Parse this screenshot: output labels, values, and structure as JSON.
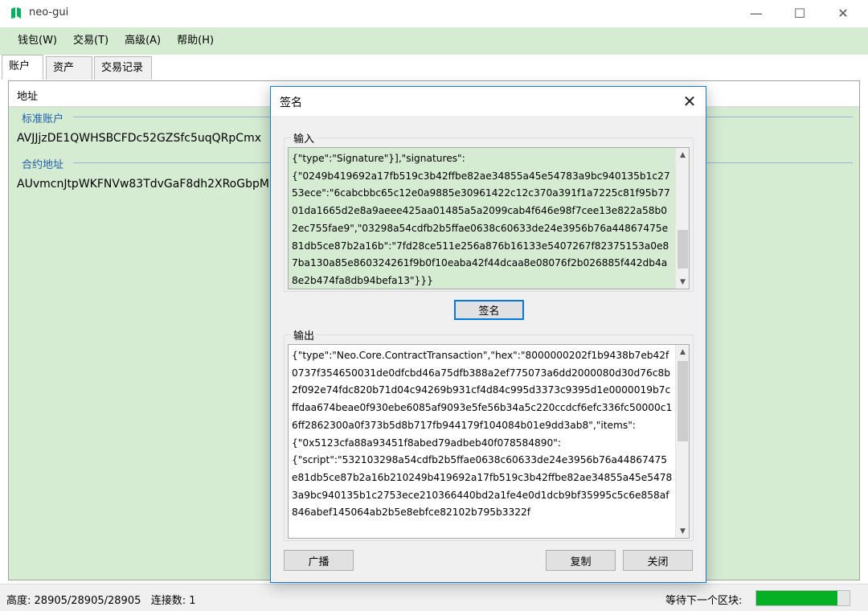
{
  "app": {
    "title": "neo-gui",
    "brand_color": "#00af5c"
  },
  "window_controls": {
    "minimize": "—",
    "maximize": "☐",
    "close": "✕"
  },
  "menu": [
    {
      "label": "钱包(W)"
    },
    {
      "label": "交易(T)"
    },
    {
      "label": "高级(A)"
    },
    {
      "label": "帮助(H)"
    }
  ],
  "tabs": [
    {
      "label": "账户",
      "active": true
    },
    {
      "label": "资产",
      "active": false
    },
    {
      "label": "交易记录",
      "active": false
    }
  ],
  "accounts": {
    "column_header": "地址",
    "groups": [
      {
        "label": "标准账户",
        "address": "AVJJjzDE1QWHSBCFDc52GZSfc5uqQRpCmx"
      },
      {
        "label": "合约地址",
        "address": "AUvmcnJtpWKFNVw83TdvGaF8dh2XRoGbpM"
      }
    ]
  },
  "status": {
    "height_label": "高度:",
    "height_value": "28905/28905/28905",
    "connections_label": "连接数:",
    "connections_value": "1",
    "waiting_label": "等待下一个区块:",
    "progress_fraction": 0.87,
    "progress_color": "#06b025"
  },
  "dialog": {
    "title": "签名",
    "close_glyph": "✕",
    "input_label": "输入",
    "input_text": "{\"type\":\"Signature\"}],\"signatures\":\n{\"0249b419692a17fb519c3b42ffbe82ae34855a45e54783a9bc940135b1c2753ece\":\"6cabcbbc65c12e0a9885e30961422c12c370a391f1a7225c81f95b7701da1665d2e8a9aeee425aa01485a5a2099cab4f646e98f7cee13e822a58b02ec755fae9\",\"03298a54cdfb2b5ffae0638c60633de24e3956b76a44867475e81db5ce87b2a16b\":\"7fd28ce511e256a876b16133e5407267f82375153a0e87ba130a85e860324261f9b0f10eaba42f44dcaa8e08076f2b026885f442db4a8e2b474fa8db94befa13\"}}}",
    "input_bg": "#d5ebd2",
    "sign_button": "签名",
    "output_label": "输出",
    "output_text": "{\"type\":\"Neo.Core.ContractTransaction\",\"hex\":\"8000000202f1b9438b7eb42f0737f354650031de0dfcbd46a75dfb388a2ef775073a6dd2000080d30d76c8b2f092e74fdc820b71d04c94269b931cf4d84c995d3373c9395d1e0000019b7cffdaa674beae0f930ebe6085af9093e5fe56b34a5c220ccdcf6efc336fc50000c16ff2862300a0f373b5d8b717fb944179f104084b01e9dd3ab8\",\"items\":\n{\"0x5123cfa88a93451f8abed79adbeb40f078584890\":\n{\"script\":\"532103298a54cdfb2b5ffae0638c60633de24e3956b76a44867475e81db5ce87b2a16b210249b419692a17fb519c3b42ffbe82ae34855a45e54783a9bc940135b1c2753ece210366440bd2a1fe4e0d1dcb9bf35995c5c6e858af846abef145064ab2b5e8ebfce82102b795b3322f",
    "broadcast_button": "广播",
    "copy_button": "复制",
    "close_button": "关闭"
  }
}
